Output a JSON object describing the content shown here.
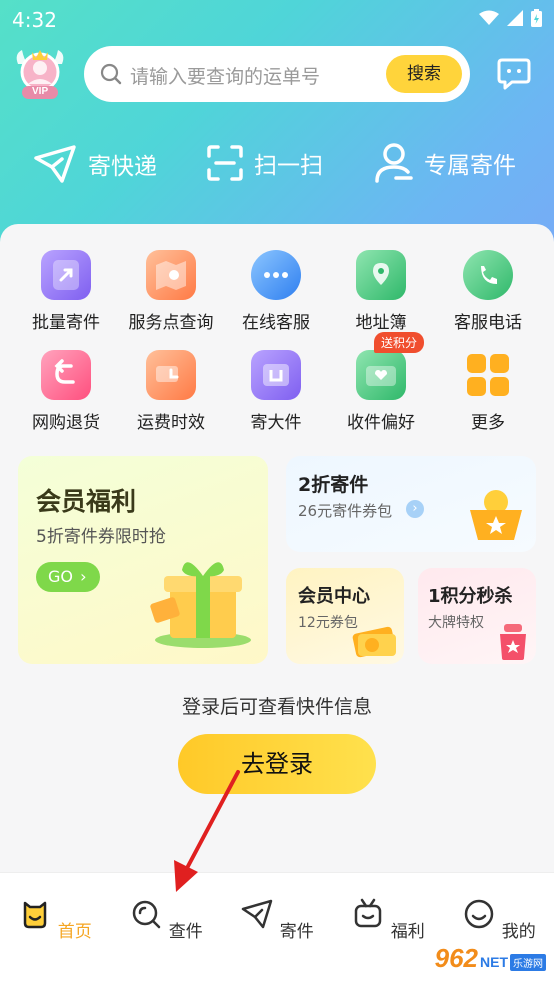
{
  "status_bar": {
    "time": "4:32"
  },
  "header": {
    "vip_label": "VIP",
    "search_placeholder": "请输入要查询的运单号",
    "search_button": "搜索"
  },
  "quick_actions": [
    {
      "label": "寄快递",
      "icon": "paper-plane-icon"
    },
    {
      "label": "扫一扫",
      "icon": "scan-icon"
    },
    {
      "label": "专属寄件",
      "icon": "user-icon"
    }
  ],
  "services": [
    {
      "label": "批量寄件",
      "icon": "batch-send-icon",
      "color": "#8a6cf0"
    },
    {
      "label": "服务点查询",
      "icon": "map-icon",
      "color": "#ff8a5c"
    },
    {
      "label": "在线客服",
      "icon": "chat-bubble-icon",
      "color": "#3d8ef5"
    },
    {
      "label": "地址簿",
      "icon": "location-book-icon",
      "color": "#3cc47c"
    },
    {
      "label": "客服电话",
      "icon": "phone-icon",
      "color": "#3cc47c"
    },
    {
      "label": "网购退货",
      "icon": "return-icon",
      "color": "#ff5c86"
    },
    {
      "label": "运费时效",
      "icon": "truck-icon",
      "color": "#ff8a5c"
    },
    {
      "label": "寄大件",
      "icon": "big-box-icon",
      "color": "#8a6cf0"
    },
    {
      "label": "收件偏好",
      "icon": "inbox-heart-icon",
      "color": "#3cc47c",
      "badge": "送积分"
    },
    {
      "label": "更多",
      "icon": "more-grid-icon",
      "color": "#ffb020"
    }
  ],
  "promo": {
    "member": {
      "title": "会员福利",
      "subtitle": "5折寄件券限时抢",
      "cta": "GO"
    },
    "discount": {
      "title": "2折寄件",
      "subtitle": "26元寄件券包"
    },
    "center": {
      "title": "会员中心",
      "subtitle": "12元券包"
    },
    "flash": {
      "title": "1积分秒杀",
      "subtitle": "大牌特权"
    }
  },
  "login": {
    "tip": "登录后可查看快件信息",
    "button": "去登录"
  },
  "tabs": [
    {
      "label": "首页",
      "icon": "home-face-icon",
      "active": true
    },
    {
      "label": "查件",
      "icon": "search-parcel-icon",
      "active": false
    },
    {
      "label": "寄件",
      "icon": "send-plane-icon",
      "active": false
    },
    {
      "label": "福利",
      "icon": "gift-tv-icon",
      "active": false
    },
    {
      "label": "我的",
      "icon": "profile-face-icon",
      "active": false
    }
  ],
  "watermark": {
    "brand": "962",
    "suffix": "NET",
    "sub": "乐游网"
  },
  "colors": {
    "accent": "#ffd43b",
    "active_tab": "#f5a623",
    "annotation": "#e02020"
  }
}
